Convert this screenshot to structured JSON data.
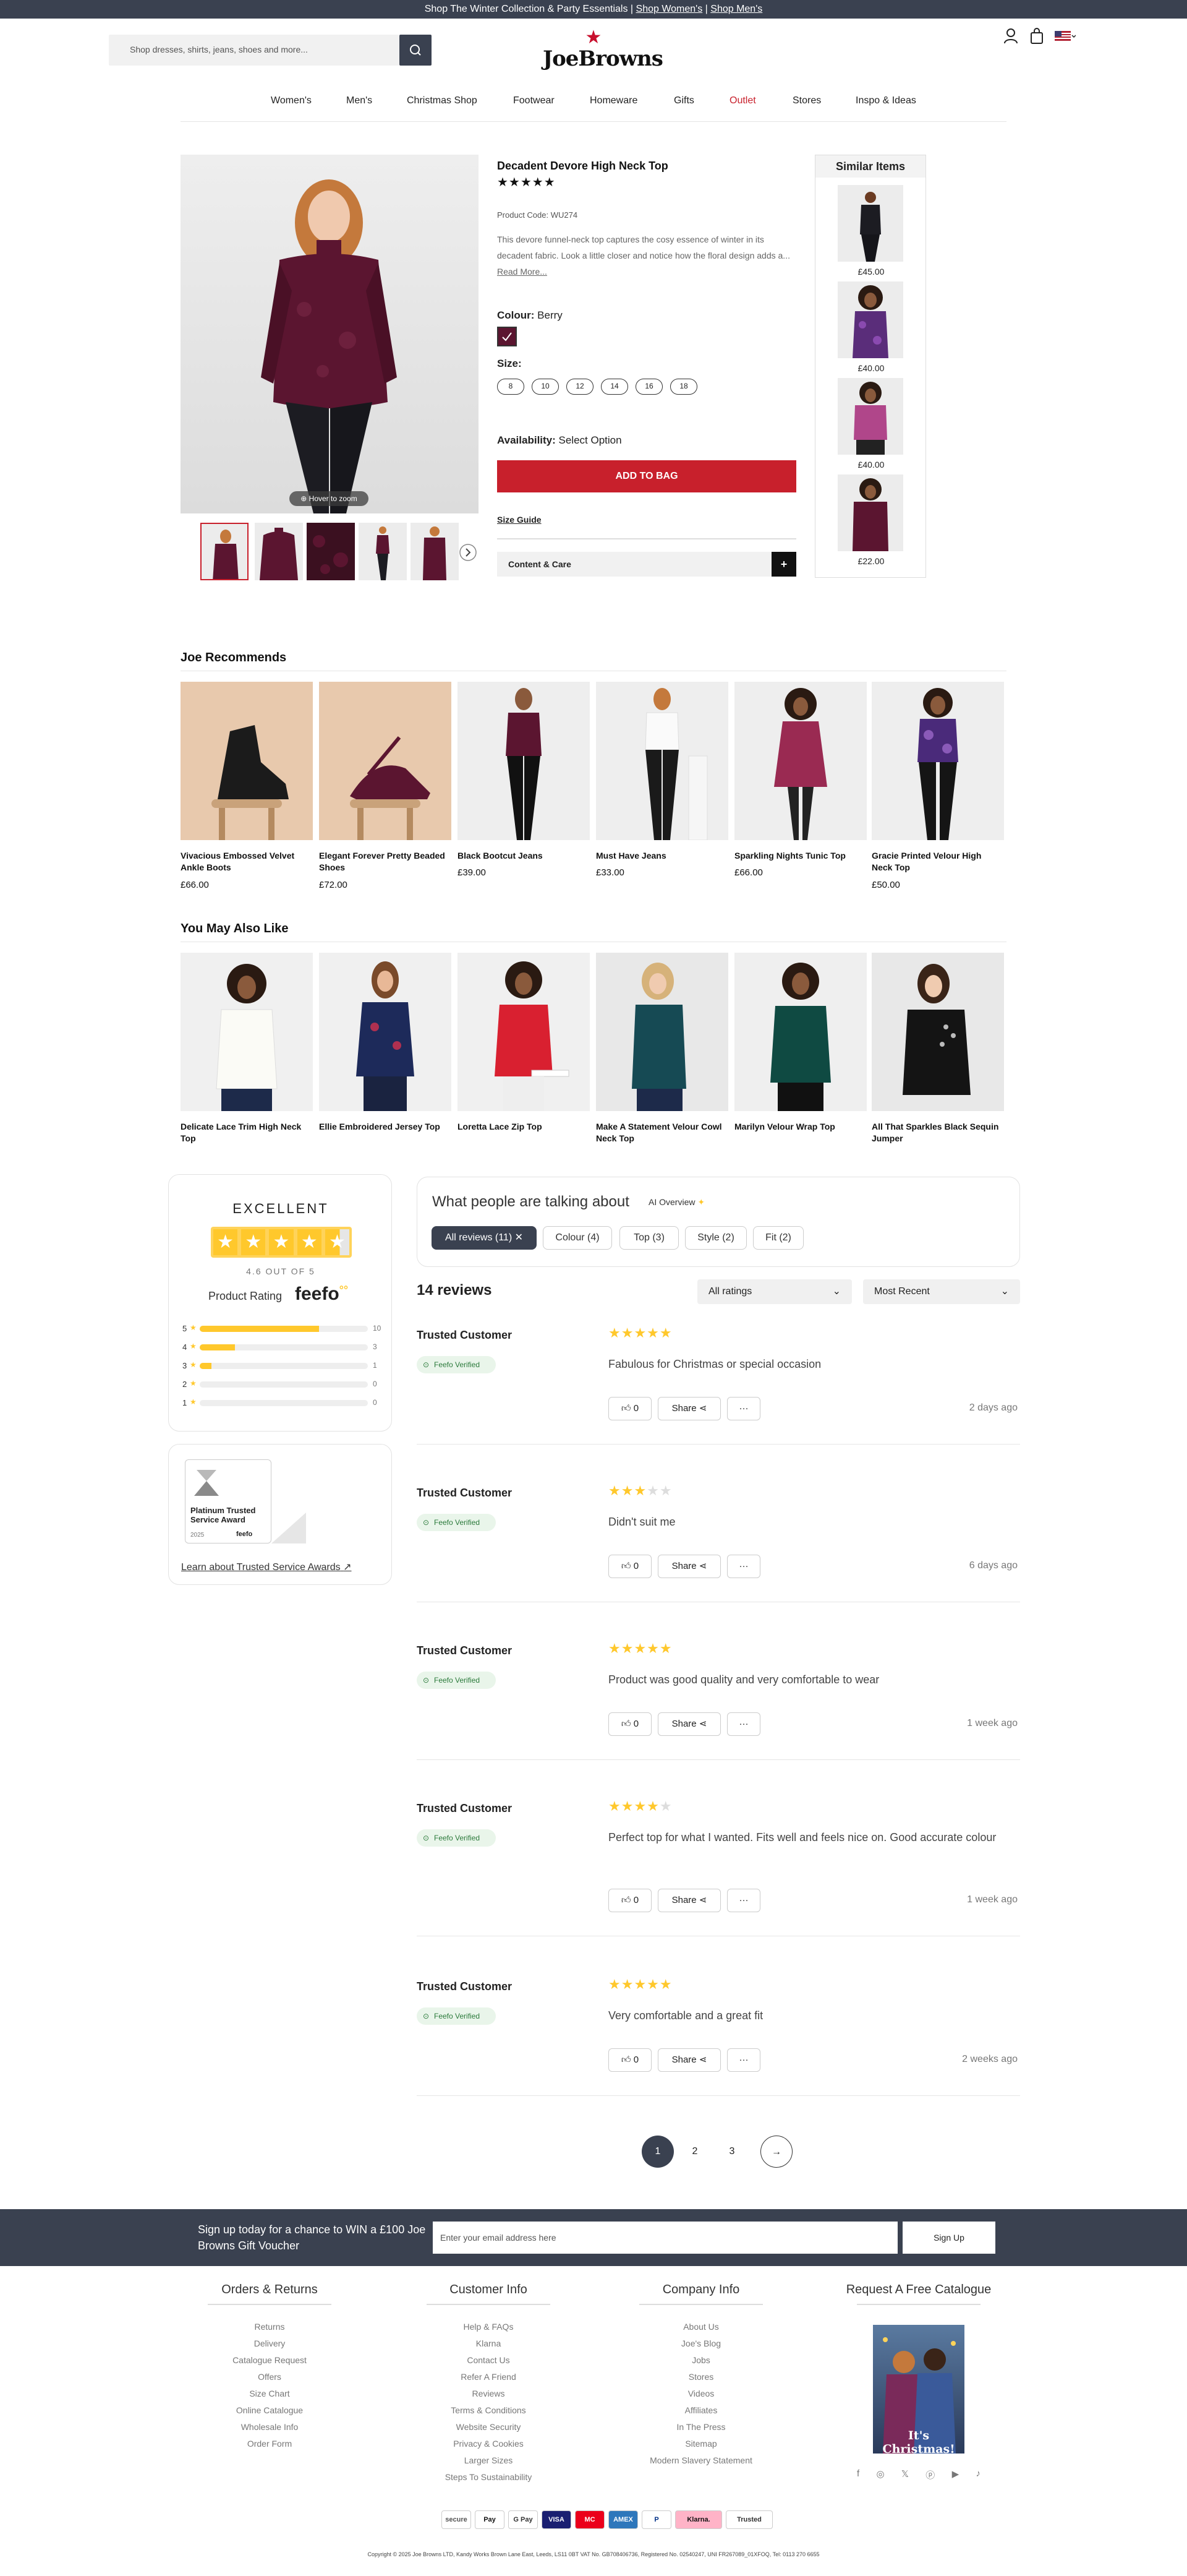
{
  "topbar": {
    "text": "Shop The Winter Collection & Party Essentials | ",
    "link1": "Shop Women's",
    "sep": " | ",
    "link2": "Shop Men's"
  },
  "search": {
    "placeholder": "Shop dresses, shirts, jeans, shoes and more..."
  },
  "logo": {
    "text": "JoeBrowns"
  },
  "nav": [
    "Women's",
    "Men's",
    "Christmas Shop",
    "Footwear",
    "Homeware",
    "Gifts",
    "Outlet",
    "Stores",
    "Inspo & Ideas"
  ],
  "product": {
    "title": "Decadent Devore High Neck Top",
    "rating_stars": "★★★★★",
    "code": "Product Code: WU274",
    "description": "This devore funnel-neck top captures the cosy essence of winter in its decadent fabric. Look a little closer and notice how the floral design adds a...",
    "read_more": "Read More...",
    "colour_label": "Colour:",
    "colour_value": "Berry",
    "size_label": "Size:",
    "sizes": [
      "8",
      "10",
      "12",
      "14",
      "16",
      "18"
    ],
    "availability_label": "Availability:",
    "availability_value": "Select Option",
    "add_to_bag": "ADD TO BAG",
    "size_guide": "Size Guide",
    "content_care": "Content & Care",
    "hover_zoom": "Hover to zoom"
  },
  "similar": {
    "title": "Similar Items",
    "prices": [
      "£45.00",
      "£40.00",
      "£40.00",
      "£22.00"
    ]
  },
  "recommends": {
    "title": "Joe Recommends",
    "items": [
      {
        "name": "Vivacious Embossed Velvet Ankle Boots",
        "price": "£66.00"
      },
      {
        "name": "Elegant Forever Pretty Beaded Shoes",
        "price": "£72.00"
      },
      {
        "name": "Black Bootcut Jeans",
        "price": "£39.00"
      },
      {
        "name": "Must Have Jeans",
        "price": "£33.00"
      },
      {
        "name": "Sparkling Nights Tunic Top",
        "price": "£66.00"
      },
      {
        "name": "Gracie Printed Velour High Neck Top",
        "price": "£50.00"
      }
    ]
  },
  "also_like": {
    "title": "You May Also Like",
    "items": [
      {
        "name": "Delicate Lace Trim High Neck Top"
      },
      {
        "name": "Ellie Embroidered Jersey Top"
      },
      {
        "name": "Loretta Lace Zip Top"
      },
      {
        "name": "Make A Statement Velour Cowl Neck Top"
      },
      {
        "name": "Marilyn Velour Wrap Top"
      },
      {
        "name": "All That Sparkles Black Sequin Jumper"
      }
    ]
  },
  "feefo": {
    "excellent": "EXCELLENT",
    "score": "4.6 OUT OF 5",
    "product_rating": "Product Rating",
    "brand": "feefo",
    "breakdown": [
      {
        "star": "5",
        "count": "10",
        "fraction": 0.71
      },
      {
        "star": "4",
        "count": "3",
        "fraction": 0.21
      },
      {
        "star": "3",
        "count": "1",
        "fraction": 0.07
      },
      {
        "star": "2",
        "count": "0",
        "fraction": 0
      },
      {
        "star": "1",
        "count": "0",
        "fraction": 0
      }
    ],
    "award_title": "Platinum Trusted Service Award",
    "award_year": "2025",
    "award_link": "Learn about Trusted Service Awards"
  },
  "reviews": {
    "talking_title": "What people are talking about",
    "ai_overview": "AI Overview",
    "filters": [
      "All reviews (11)",
      "Colour (4)",
      "Top (3)",
      "Style (2)",
      "Fit (2)"
    ],
    "count": "14 reviews",
    "ratings_select": "All ratings",
    "sort_select": "Most Recent",
    "items": [
      {
        "name": "Trusted Customer",
        "verified": "Feefo Verified",
        "stars": 5,
        "text": "Fabulous for Christmas or special occasion",
        "likes": "0",
        "share": "Share",
        "time": "2 days ago"
      },
      {
        "name": "Trusted Customer",
        "verified": "Feefo Verified",
        "stars": 3,
        "text": "Didn't suit me",
        "likes": "0",
        "share": "Share",
        "time": "6 days ago"
      },
      {
        "name": "Trusted Customer",
        "verified": "Feefo Verified",
        "stars": 5,
        "text": "Product was good quality and very comfortable to wear",
        "likes": "0",
        "share": "Share",
        "time": "1 week ago"
      },
      {
        "name": "Trusted Customer",
        "verified": "Feefo Verified",
        "stars": 4,
        "text": "Perfect top for what I wanted. Fits well and feels nice on. Good accurate colour",
        "likes": "0",
        "share": "Share",
        "time": "1 week ago"
      },
      {
        "name": "Trusted Customer",
        "verified": "Feefo Verified",
        "stars": 5,
        "text": "Very comfortable and a great fit",
        "likes": "0",
        "share": "Share",
        "time": "2 weeks ago"
      }
    ],
    "pages": [
      "1",
      "2",
      "3"
    ]
  },
  "signup": {
    "text": "Sign up today for a chance to WIN a £100 Joe Browns Gift Voucher",
    "placeholder": "Enter your email address here",
    "button": "Sign Up"
  },
  "footer": {
    "cols": [
      {
        "title": "Orders & Returns",
        "links": [
          "Returns",
          "Delivery",
          "Catalogue Request",
          "Offers",
          "Size Chart",
          "Online Catalogue",
          "Wholesale Info",
          "Order Form"
        ]
      },
      {
        "title": "Customer Info",
        "links": [
          "Help & FAQs",
          "Klarna",
          "Contact Us",
          "Refer A Friend",
          "Reviews",
          "Terms & Conditions",
          "Website Security",
          "Privacy & Cookies",
          "Larger Sizes",
          "Steps To Sustainability"
        ]
      },
      {
        "title": "Company Info",
        "links": [
          "About Us",
          "Joe's Blog",
          "Jobs",
          "Stores",
          "Videos",
          "Affiliates",
          "In The Press",
          "Sitemap",
          "Modern Slavery Statement"
        ]
      }
    ],
    "catalogue_title": "Request A Free Catalogue",
    "catalogue_cover_text": "It's Christmas!",
    "payments": [
      "secure",
      "Pay",
      "G Pay",
      "VISA",
      "MC",
      "AMEX",
      "P",
      "Klarna.",
      "Trusted"
    ],
    "copyright": "Copyright © 2025 Joe Browns LTD, Kandy Works Brown Lane East, Leeds, LS11 0BT VAT No. GB708406736, Registered No. 02540247, UNI FR267089_01XFOQ, Tel: 0113 270 6655"
  },
  "colors": {
    "accent_red": "#c8202c",
    "dark_bar": "#3a4150",
    "star_yellow": "#ffc82c",
    "outlet_red": "#c8202c",
    "berry": "#5b1530"
  }
}
